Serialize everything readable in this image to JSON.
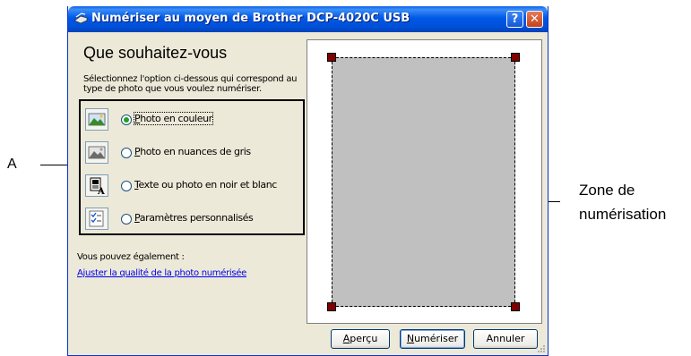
{
  "window": {
    "title": "Numériser au moyen de Brother DCP-4020C USB",
    "help_button": "?",
    "close_button": "✕"
  },
  "heading": "Que souhaitez-vous",
  "description": "Sélectionnez l'option ci-dessous qui correspond au type de photo que vous voulez numériser.",
  "options": [
    {
      "label_pre": "",
      "accel": "P",
      "label_post": "hoto en couleur",
      "icon": "color-photo-icon",
      "selected": true
    },
    {
      "label_pre": "",
      "accel": "P",
      "label_post": "hoto en nuances de gris",
      "icon": "grayscale-photo-icon",
      "selected": false
    },
    {
      "label_pre": "",
      "accel": "T",
      "label_post": "exte ou photo en noir et blanc",
      "icon": "text-document-icon",
      "selected": false
    },
    {
      "label_pre": "",
      "accel": "P",
      "label_post": "aramètres personnalisés",
      "icon": "custom-settings-icon",
      "selected": false
    }
  ],
  "also_label": "Vous pouvez également :",
  "adjust_link": "Ajuster la qualité de la photo numérisée",
  "buttons": {
    "preview": {
      "pre": "",
      "accel": "A",
      "post": "perçu"
    },
    "scan": {
      "pre": "",
      "accel": "N",
      "post": "umériser"
    },
    "cancel": "Annuler"
  },
  "annotations": {
    "a_label": "A",
    "zone_line1": "Zone de",
    "zone_line2": "numérisation"
  },
  "colors": {
    "titlebar": "#0058e6",
    "dialog_bg": "#ece9d8",
    "scan_area": "#c0c0c0",
    "handle": "#800000",
    "radio_selected": "#21a121"
  }
}
